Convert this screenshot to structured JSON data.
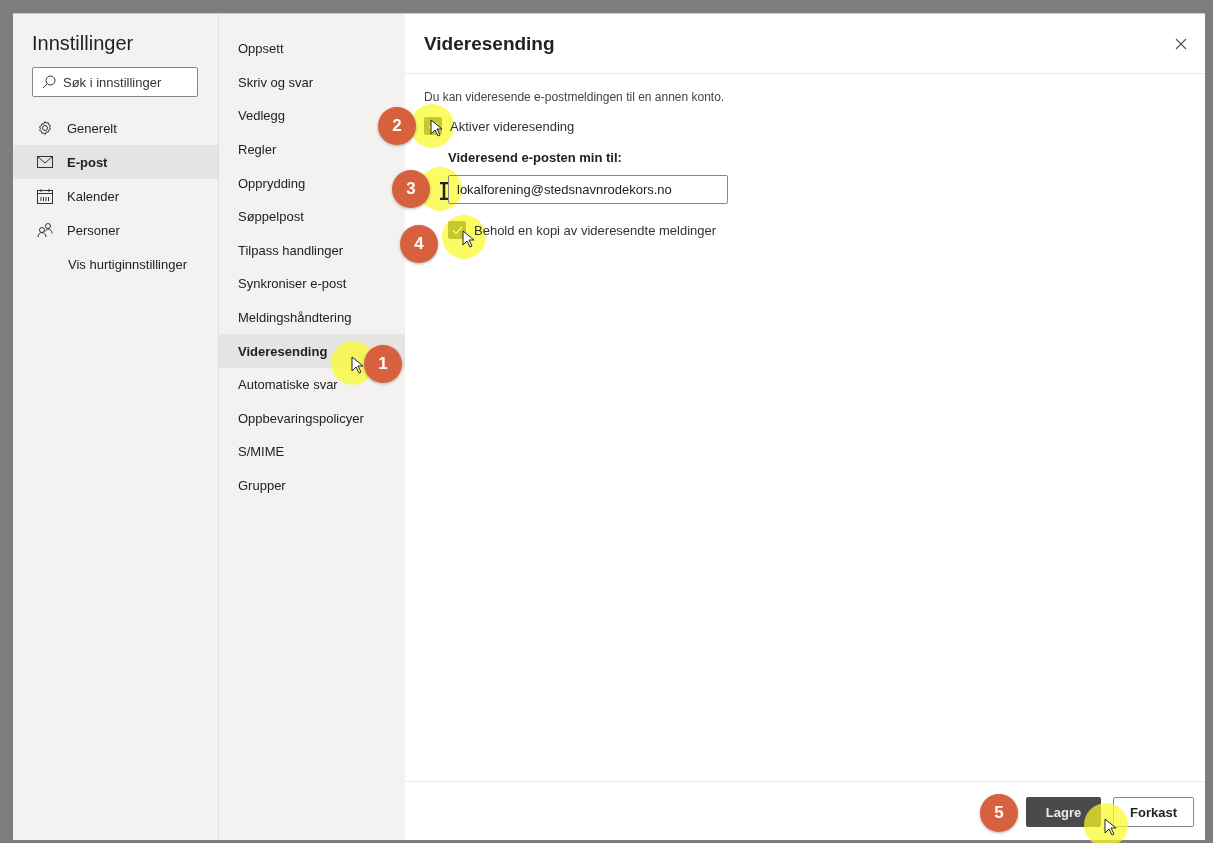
{
  "sidebar": {
    "title": "Innstillinger",
    "search": {
      "placeholder": "Søk i innstillinger"
    },
    "items": [
      {
        "label": "Generelt",
        "selected": false
      },
      {
        "label": "E-post",
        "selected": true
      },
      {
        "label": "Kalender",
        "selected": false
      },
      {
        "label": "Personer",
        "selected": false
      }
    ],
    "quick_settings_link": "Vis hurtiginnstillinger"
  },
  "subnav": {
    "items": [
      {
        "label": "Oppsett",
        "selected": false
      },
      {
        "label": "Skriv og svar",
        "selected": false
      },
      {
        "label": "Vedlegg",
        "selected": false
      },
      {
        "label": "Regler",
        "selected": false
      },
      {
        "label": "Opprydding",
        "selected": false
      },
      {
        "label": "Søppelpost",
        "selected": false
      },
      {
        "label": "Tilpass handlinger",
        "selected": false
      },
      {
        "label": "Synkroniser e-post",
        "selected": false
      },
      {
        "label": "Meldingshåndtering",
        "selected": false
      },
      {
        "label": "Videresending",
        "selected": true,
        "callout": "1"
      },
      {
        "label": "Automatiske svar",
        "selected": false
      },
      {
        "label": "Oppbevaringspolicyer",
        "selected": false
      },
      {
        "label": "S/MIME",
        "selected": false
      },
      {
        "label": "Grupper",
        "selected": false
      }
    ]
  },
  "panel": {
    "title": "Videresending",
    "description": "Du kan videresende e-postmeldingen til en annen konto.",
    "enable_forwarding": {
      "label": "Aktiver videresending",
      "checked": true,
      "callout": "2"
    },
    "forward_to": {
      "label": "Videresend e-posten min til:",
      "value": "lokalforening@stedsnavnrodekors.no",
      "callout": "3"
    },
    "keep_copy": {
      "label": "Behold en kopi av videresendte meldinger",
      "checked": true,
      "callout": "4"
    },
    "buttons": [
      {
        "label": "Lagre",
        "kind": "primary",
        "callout": "5"
      },
      {
        "label": "Forkast",
        "kind": "secondary"
      }
    ]
  }
}
